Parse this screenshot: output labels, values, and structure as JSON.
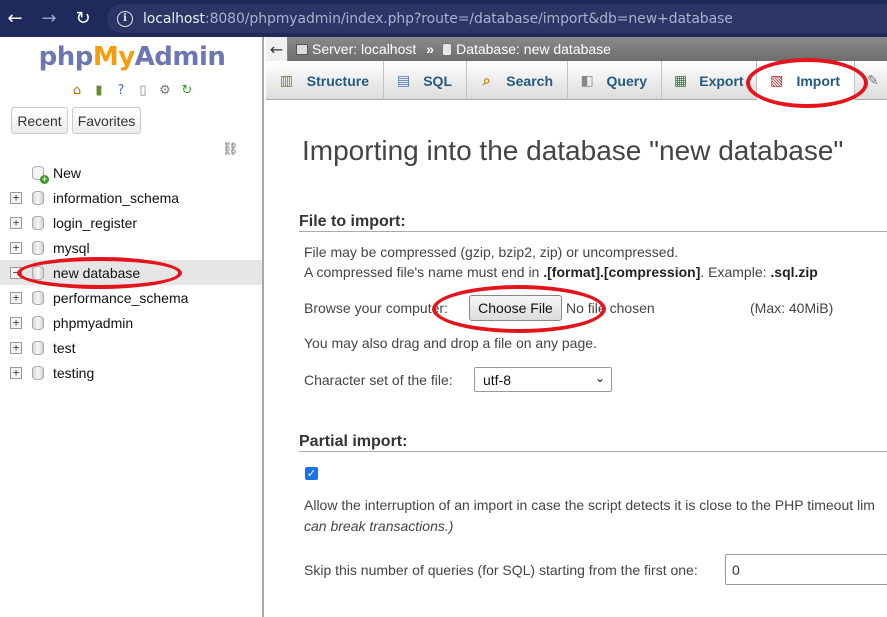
{
  "browser": {
    "url_host": "localhost",
    "url_rest": ":8080/phpmyadmin/index.php?route=/database/import&db=new+database"
  },
  "sidebar": {
    "logo": {
      "php": "php",
      "my": "My",
      "admin": "Admin"
    },
    "recent_label": "Recent",
    "favorites_label": "Favorites",
    "items": [
      {
        "label": "New",
        "type": "new"
      },
      {
        "label": "information_schema",
        "type": "db"
      },
      {
        "label": "login_register",
        "type": "db"
      },
      {
        "label": "mysql",
        "type": "db"
      },
      {
        "label": "new database",
        "type": "db",
        "selected": true
      },
      {
        "label": "performance_schema",
        "type": "db"
      },
      {
        "label": "phpmyadmin",
        "type": "db"
      },
      {
        "label": "test",
        "type": "db"
      },
      {
        "label": "testing",
        "type": "db"
      }
    ]
  },
  "breadcrumb": {
    "server": "Server: localhost",
    "separator": "»",
    "database": "Database: new database"
  },
  "tabs": [
    {
      "label": "Structure",
      "icon": "structure-icon"
    },
    {
      "label": "SQL",
      "icon": "sql-icon"
    },
    {
      "label": "Search",
      "icon": "search-icon"
    },
    {
      "label": "Query",
      "icon": "query-icon"
    },
    {
      "label": "Export",
      "icon": "export-icon"
    },
    {
      "label": "Import",
      "icon": "import-icon",
      "active": true
    }
  ],
  "main": {
    "title": "Importing into the database \"new database\"",
    "file_section": {
      "heading": "File to import:",
      "compress_line": "File may be compressed (gzip, bzip2, zip) or uncompressed.",
      "name_line_prefix": "A compressed file's name must end in ",
      "name_line_format": ".[format].[compression]",
      "name_line_mid": ". Example: ",
      "name_line_example": ".sql.zip",
      "browse_label": "Browse your computer:",
      "choose_button": "Choose File",
      "no_file": "No file chosen",
      "max_size": "(Max: 40MiB)",
      "drag_drop": "You may also drag and drop a file on any page.",
      "charset_label": "Character set of the file:",
      "charset_value": "utf-8"
    },
    "partial_section": {
      "heading": "Partial import:",
      "allow_interrupt_line1": "Allow the interruption of an import in case the script detects it is close to the PHP timeout lim",
      "allow_interrupt_line2": "can break transactions.)",
      "skip_label": "Skip this number of queries (for SQL) starting from the first one:",
      "skip_value": "0"
    }
  },
  "colors": {
    "annotation": "#e4141d",
    "tab_text": "#235a81",
    "browser_bg": "#1f2a5c"
  }
}
